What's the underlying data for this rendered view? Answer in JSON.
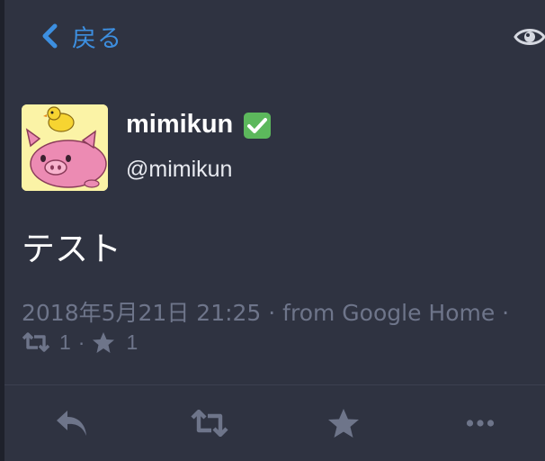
{
  "header": {
    "back_label": "戻る",
    "back_icon": "chevron-left-icon",
    "view_icon": "eye-icon"
  },
  "profile": {
    "display_name": "mimikun",
    "handle": "@mimikun",
    "verified_icon": "verified-check-icon",
    "avatar": "pig-with-chick-avatar"
  },
  "tweet": {
    "text": "テスト",
    "meta": "2018年5月21日 21:25 · from Google Home ·",
    "retweet_count": "1",
    "separator": "·",
    "favorite_count": "1"
  },
  "actions": {
    "icons": [
      "reply-icon",
      "retweet-icon",
      "favorite-star-icon",
      "more-icon"
    ]
  },
  "colors": {
    "background": "#2f3341",
    "accent": "#3d8fe0",
    "muted": "#6e758a",
    "verified": "#5cb85c"
  }
}
